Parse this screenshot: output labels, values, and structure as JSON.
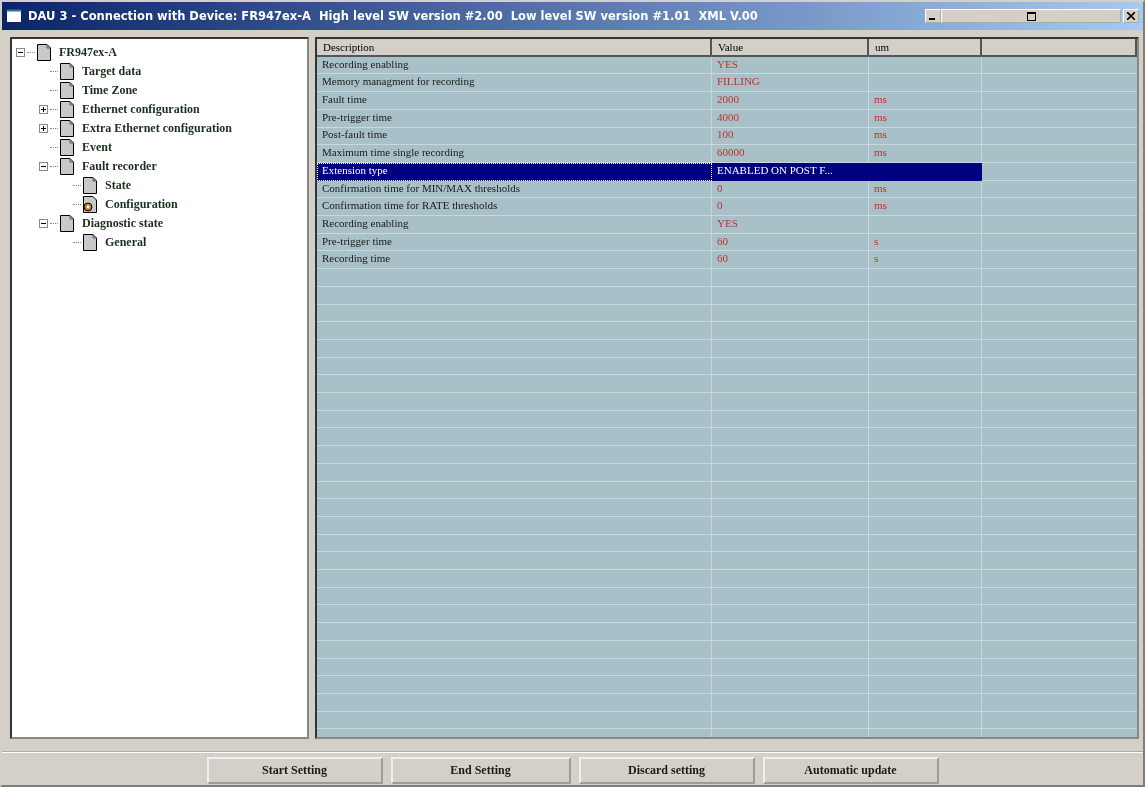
{
  "window": {
    "title": "DAU 3 - Connection with Device: FR947ex-A  High level SW version #2.00  Low level SW version #1.01  XML V.00"
  },
  "tree": [
    {
      "label": "FR947ex-A",
      "kind": "page",
      "expanded": true,
      "children": [
        {
          "label": "Target data",
          "kind": "page"
        },
        {
          "label": "Time Zone",
          "kind": "page"
        },
        {
          "label": "Ethernet configuration",
          "kind": "page",
          "expanded": false
        },
        {
          "label": "Extra Ethernet configuration",
          "kind": "page",
          "expanded": false
        },
        {
          "label": "Event",
          "kind": "page"
        },
        {
          "label": "Fault recorder",
          "kind": "page",
          "expanded": true,
          "children": [
            {
              "label": "State",
              "kind": "page"
            },
            {
              "label": "Configuration",
              "kind": "config"
            }
          ]
        },
        {
          "label": "Diagnostic state",
          "kind": "page",
          "expanded": true,
          "children": [
            {
              "label": "General",
              "kind": "page"
            }
          ]
        }
      ]
    }
  ],
  "table": {
    "columns": [
      "Description",
      "Value",
      "um"
    ],
    "rows": [
      {
        "description": "Recording enabling",
        "value": "YES",
        "um": "",
        "selected": false
      },
      {
        "description": "Memory managment for recording",
        "value": "FILLING",
        "um": "",
        "selected": false
      },
      {
        "description": "Fault time",
        "value": "2000",
        "um": "ms",
        "selected": false
      },
      {
        "description": "Pre-trigger time",
        "value": "4000",
        "um": "ms",
        "selected": false
      },
      {
        "description": "Post-fault time",
        "value": "100",
        "um": "ms",
        "selected": false
      },
      {
        "description": "Maximum time single recording",
        "value": "60000",
        "um": "ms",
        "selected": false
      },
      {
        "description": "Extension type",
        "value": "ENABLED ON POST F...",
        "um": "",
        "selected": true
      },
      {
        "description": "Confirmation time for MIN/MAX thresholds",
        "value": "0",
        "um": "ms",
        "selected": false
      },
      {
        "description": "Confirmation time for RATE thresholds",
        "value": "0",
        "um": "ms",
        "selected": false
      },
      {
        "description": "Recording enabling",
        "value": "YES",
        "um": "",
        "selected": false
      },
      {
        "description": "Pre-trigger time",
        "value": "60",
        "um": "s",
        "selected": false
      },
      {
        "description": "Recording time",
        "value": "60",
        "um": "s",
        "selected": false
      }
    ]
  },
  "buttons": [
    "Start Setting",
    "End Setting",
    "Discard setting",
    "Automatic update"
  ]
}
